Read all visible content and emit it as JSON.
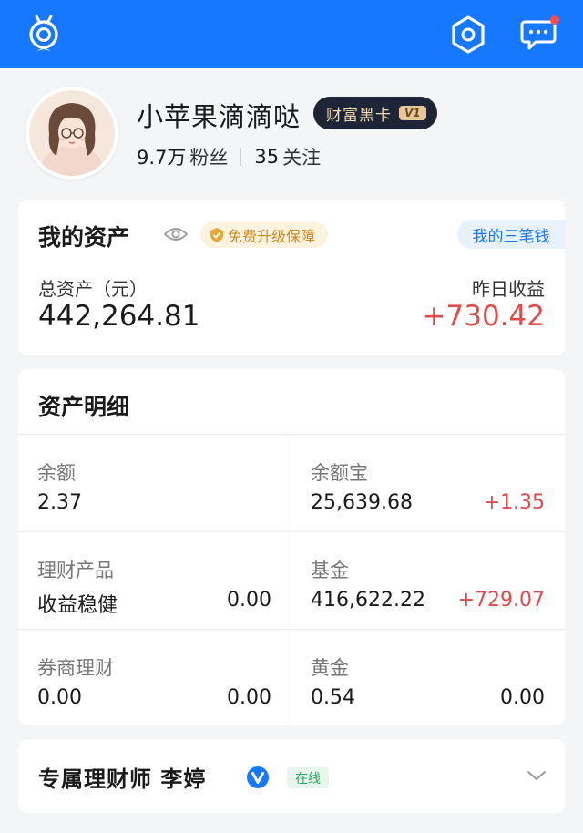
{
  "header": {
    "logo_icon": "mascot-logo-icon",
    "settings_icon": "hexagon-settings-icon",
    "message_icon": "chat-message-icon",
    "notification_dot": true,
    "bg_color": "#1677ff"
  },
  "profile": {
    "name": "小苹果滴滴哒",
    "badge": {
      "text": "财富黑卡",
      "level": "V1"
    },
    "fans_count": "9.7万",
    "fans_label": "粉丝",
    "following_count": "35",
    "following_label": "关注",
    "avatar_icon": "avatar-girl-icon"
  },
  "assets": {
    "title": "我的资产",
    "eye_icon": "eye-icon",
    "protection_label": "免费升级保障",
    "three_money_label": "我的三笔钱",
    "total_label": "总资产（元）",
    "total_value": "442,264.81",
    "yesterday_label": "昨日收益",
    "yesterday_value": "+730.42"
  },
  "detail": {
    "title": "资产明细",
    "cells": [
      {
        "label": "余额",
        "value": "2.37",
        "right": ""
      },
      {
        "label": "余额宝",
        "value": "25,639.68",
        "right": "+1.35"
      },
      {
        "label": "理财产品",
        "value": "收益稳健",
        "right": "0.00"
      },
      {
        "label": "基金",
        "value": "416,622.22",
        "right": "+729.07"
      },
      {
        "label": "券商理财",
        "value": "0.00",
        "right": "0.00"
      },
      {
        "label": "黄金",
        "value": "0.54",
        "right": "0.00"
      }
    ]
  },
  "advisor": {
    "title": "专属理财师 李婷",
    "verified_icon": "verified-v-icon",
    "status": "在线",
    "chevron_icon": "chevron-down-icon"
  },
  "colors": {
    "accent": "#1677ff",
    "positive": "#e24a4a",
    "online": "#2aa862",
    "gold": "#c98a22"
  }
}
